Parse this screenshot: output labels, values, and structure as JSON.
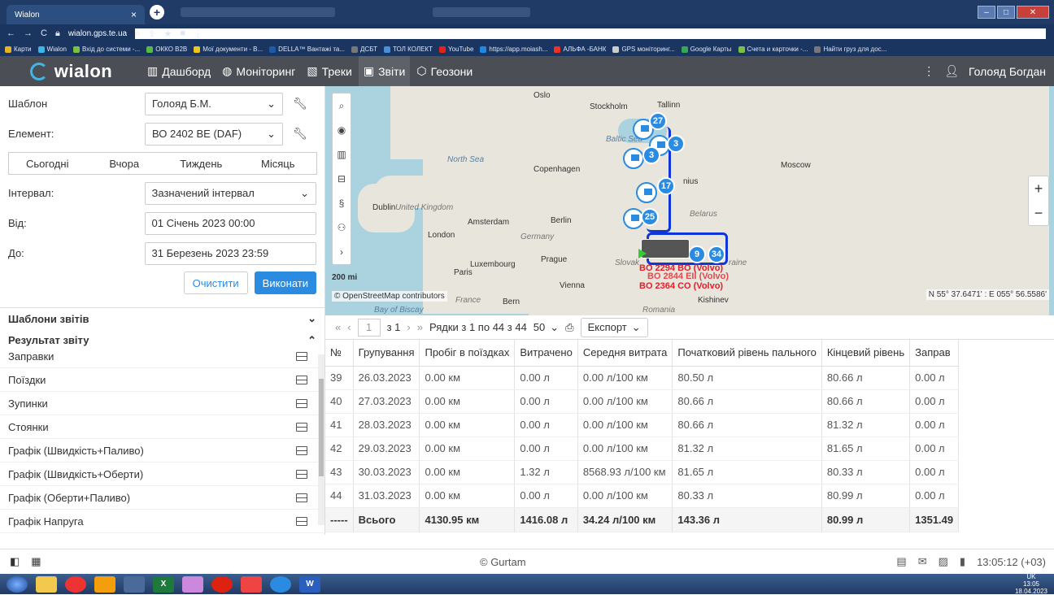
{
  "browser": {
    "tab_title": "Wialon",
    "url": "wialon.gps.te.ua",
    "bookmarks": [
      "Карти",
      "Wialon",
      "Вхід до системи -...",
      "ОККО B2B",
      "Мої документи - В...",
      "DELLA™ Вантажі та...",
      "ДСБТ",
      "ТОЛ КОЛЕКТ",
      "YouTube",
      "https://app.moiash...",
      "АЛЬФА -БАНК",
      "GPS моніторинг...",
      "Google Карты",
      "Счета и карточки -...",
      "Найти груз для дос..."
    ]
  },
  "app": {
    "logo": "wialon",
    "nav": [
      {
        "label": "Дашборд",
        "icon": "chart-icon"
      },
      {
        "label": "Моніторинг",
        "icon": "globe-icon"
      },
      {
        "label": "Треки",
        "icon": "track-icon"
      },
      {
        "label": "Звіти",
        "icon": "report-icon"
      },
      {
        "label": "Геозони",
        "icon": "geofence-icon"
      }
    ],
    "user_name": "Голояд Богдан"
  },
  "form": {
    "template_label": "Шаблон",
    "template_value": "Голояд Б.М.",
    "element_label": "Елемент:",
    "element_value": "ВО 2402 ВЕ (DAF)",
    "day_tabs": [
      "Сьогодні",
      "Вчора",
      "Тиждень",
      "Місяць"
    ],
    "interval_label": "Інтервал:",
    "interval_value": "Зазначений інтервал",
    "from_label": "Від:",
    "from_value": "01 Січень 2023 00:00",
    "to_label": "До:",
    "to_value": "31 Березень 2023 23:59",
    "clear_label": "Очистити",
    "run_label": "Виконати"
  },
  "sections": {
    "templates": "Шаблони звітів",
    "result": "Результат звіту"
  },
  "result_items": [
    "Заправки",
    "Поїздки",
    "Зупинки",
    "Стоянки",
    "Графік (Швидкість+Паливо)",
    "Графік (Швидкість+Оберти)",
    "Графік (Оберти+Паливо)",
    "Графік Напруга"
  ],
  "map": {
    "cities": [
      "Oslo",
      "Stockholm",
      "Tallinn",
      "Moscow",
      "Copenhagen",
      "Dublin",
      "United Kingdom",
      "Amsterdam",
      "Berlin",
      "Belarus",
      "London",
      "Germany",
      "Prague",
      "Luxembourg",
      "Paris",
      "Vienna",
      "France",
      "Bern",
      "Kishinev",
      "Romania",
      "nius",
      "raine",
      "Slovak"
    ],
    "seas": [
      "Baltic Sea",
      "North Sea",
      "Bay of Biscay"
    ],
    "scale": "200 mi",
    "osm": "© OpenStreetMap contributors",
    "coords": "N 55° 37.6471' : E 055° 56.5586'",
    "badges": [
      "27",
      "3",
      "3",
      "17",
      "25",
      "34",
      "9"
    ],
    "vehicle_labels": [
      "BO 2294 BO (Volvo)",
      "BO 2844 EII (Volvo)",
      "BO 2364 CO (Volvo)"
    ]
  },
  "pager": {
    "page": "1",
    "of": "з 1",
    "rows_text": "Рядки з 1 по 44 з 44",
    "page_size": "50",
    "export_label": "Експорт"
  },
  "table": {
    "headers": [
      "№",
      "Групування",
      "Пробіг в поїздках",
      "Витрачено",
      "Середня витрата",
      "Початковий рівень пального",
      "Кінцевий рівень",
      "Заправ"
    ],
    "rows": [
      [
        "39",
        "26.03.2023",
        "0.00 км",
        "0.00 л",
        "0.00 л/100 км",
        "80.50 л",
        "80.66 л",
        "0.00 л"
      ],
      [
        "40",
        "27.03.2023",
        "0.00 км",
        "0.00 л",
        "0.00 л/100 км",
        "80.66 л",
        "80.66 л",
        "0.00 л"
      ],
      [
        "41",
        "28.03.2023",
        "0.00 км",
        "0.00 л",
        "0.00 л/100 км",
        "80.66 л",
        "81.32 л",
        "0.00 л"
      ],
      [
        "42",
        "29.03.2023",
        "0.00 км",
        "0.00 л",
        "0.00 л/100 км",
        "81.32 л",
        "81.65 л",
        "0.00 л"
      ],
      [
        "43",
        "30.03.2023",
        "0.00 км",
        "1.32 л",
        "8568.93 л/100 км",
        "81.65 л",
        "80.33 л",
        "0.00 л"
      ],
      [
        "44",
        "31.03.2023",
        "0.00 км",
        "0.00 л",
        "0.00 л/100 км",
        "80.33 л",
        "80.99 л",
        "0.00 л"
      ]
    ],
    "total": [
      "-----",
      "Всього",
      "4130.95 км",
      "1416.08 л",
      "34.24 л/100 км",
      "143.36 л",
      "80.99 л",
      "1351.49"
    ]
  },
  "footer": {
    "copyright": "© Gurtam",
    "time": "13:05:12 (+03)"
  },
  "taskbar": {
    "clock_time": "13:05",
    "clock_date": "18.04.2023",
    "lang": "UK"
  }
}
